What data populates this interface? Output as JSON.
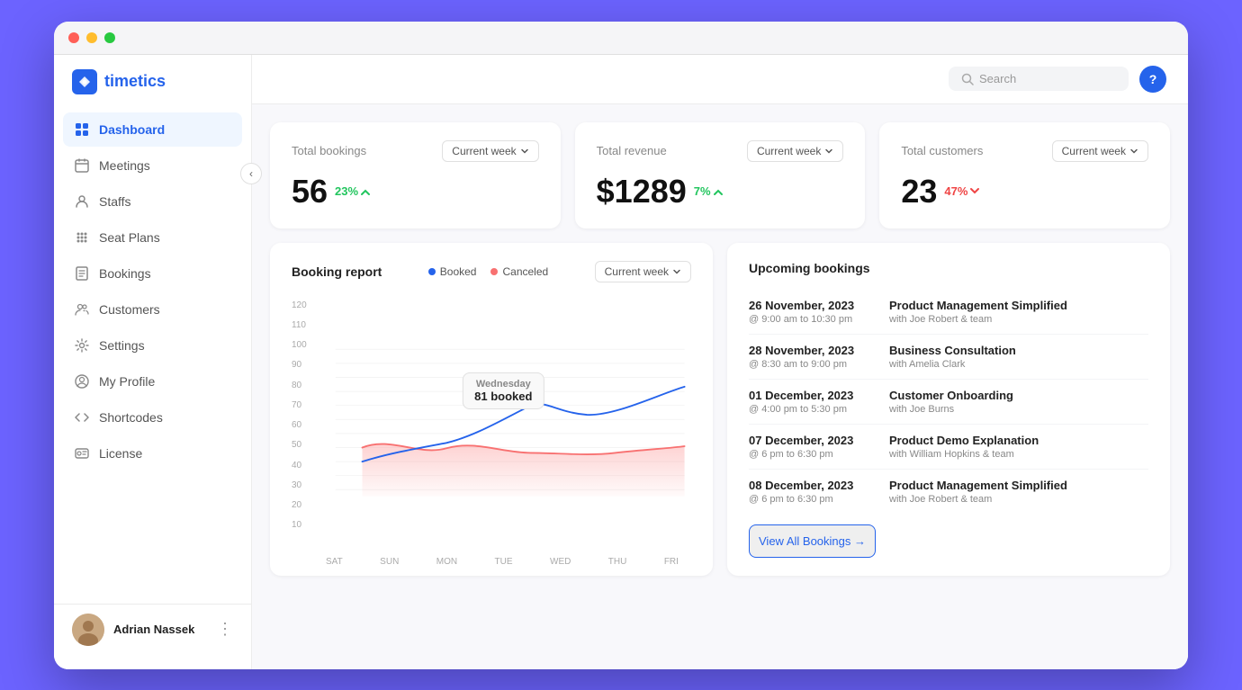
{
  "app": {
    "name": "timetics",
    "window_title": "Dashboard"
  },
  "header": {
    "search_placeholder": "Search",
    "help_label": "?",
    "collapse_icon": "‹"
  },
  "sidebar": {
    "logo": "timetics",
    "items": [
      {
        "id": "dashboard",
        "label": "Dashboard",
        "icon": "grid",
        "active": true
      },
      {
        "id": "meetings",
        "label": "Meetings",
        "icon": "calendar",
        "active": false
      },
      {
        "id": "staffs",
        "label": "Staffs",
        "icon": "user",
        "active": false
      },
      {
        "id": "seat-plans",
        "label": "Seat Plans",
        "icon": "grid-dots",
        "active": false
      },
      {
        "id": "bookings",
        "label": "Bookings",
        "icon": "book",
        "active": false
      },
      {
        "id": "customers",
        "label": "Customers",
        "icon": "users",
        "active": false
      },
      {
        "id": "settings",
        "label": "Settings",
        "icon": "gear",
        "active": false
      },
      {
        "id": "my-profile",
        "label": "My Profile",
        "icon": "user-circle",
        "active": false
      },
      {
        "id": "shortcodes",
        "label": "Shortcodes",
        "icon": "code",
        "active": false
      },
      {
        "id": "license",
        "label": "License",
        "icon": "id-card",
        "active": false
      }
    ],
    "user": {
      "name": "Adrian Nassek",
      "avatar": "👤"
    }
  },
  "stats": {
    "bookings": {
      "title": "Total bookings",
      "value": "56",
      "change": "23%",
      "direction": "up",
      "period": "Current week"
    },
    "revenue": {
      "title": "Total revenue",
      "value": "$1289",
      "change": "7%",
      "direction": "up",
      "period": "Current week"
    },
    "customers": {
      "title": "Total customers",
      "value": "23",
      "change": "47%",
      "direction": "down",
      "period": "Current week"
    }
  },
  "chart": {
    "title": "Booking report",
    "period": "Current week",
    "legend": {
      "booked": "Booked",
      "canceled": "Canceled"
    },
    "tooltip": {
      "day": "Wednesday",
      "value": "81 booked"
    },
    "y_labels": [
      "120",
      "110",
      "100",
      "90",
      "80",
      "70",
      "60",
      "50",
      "40",
      "30",
      "20",
      "10"
    ],
    "x_labels": [
      "SAT",
      "SUN",
      "MON",
      "TUE",
      "WED",
      "THU",
      "FRI"
    ]
  },
  "upcoming": {
    "title": "Upcoming bookings",
    "bookings": [
      {
        "date": "26 November, 2023",
        "time": "@ 9:00 am to 10:30 pm",
        "name": "Product Management Simplified",
        "with": "with Joe Robert & team"
      },
      {
        "date": "28 November, 2023",
        "time": "@ 8:30 am to 9:00 pm",
        "name": "Business Consultation",
        "with": "with Amelia Clark"
      },
      {
        "date": "01 December, 2023",
        "time": "@ 4:00 pm to 5:30 pm",
        "name": "Customer Onboarding",
        "with": "with Joe Burns"
      },
      {
        "date": "07 December, 2023",
        "time": "@ 6 pm to 6:30 pm",
        "name": "Product Demo Explanation",
        "with": "with William Hopkins & team"
      },
      {
        "date": "08 December, 2023",
        "time": "@ 6 pm to 6:30 pm",
        "name": "Product Management Simplified",
        "with": "with Joe Robert & team"
      }
    ],
    "view_all_label": "View All Bookings →"
  }
}
